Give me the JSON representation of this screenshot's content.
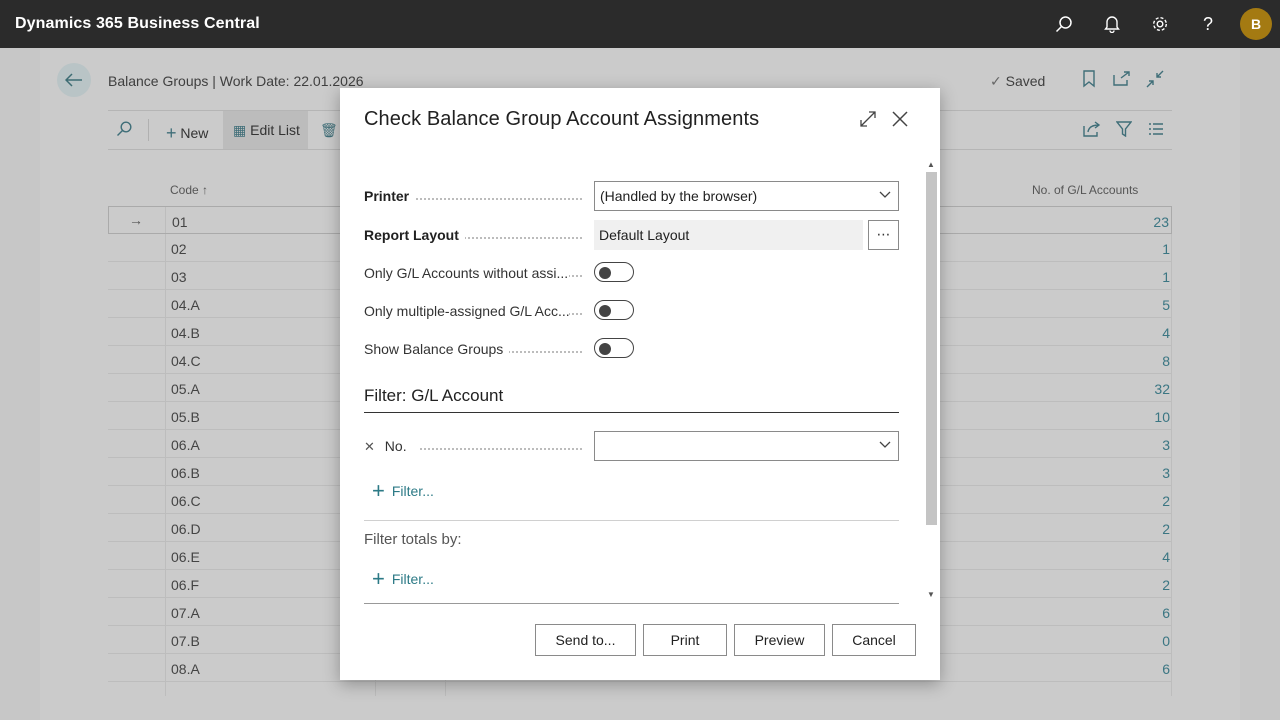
{
  "app": {
    "title": "Dynamics 365 Business Central",
    "avatar_initial": "B",
    "icons": [
      "search-icon",
      "bell-icon",
      "gear-icon",
      "help-icon"
    ]
  },
  "page": {
    "caption": "Balance Groups | Work Date: 22.01.2026",
    "saved_label": "Saved",
    "actions": {
      "new_label": "New",
      "edit_list_label": "Edit List"
    },
    "columns": {
      "code": "Code ↑",
      "count": "No. of G/L Accounts"
    },
    "rows": [
      {
        "code": "01",
        "count": "23"
      },
      {
        "code": "02",
        "count": "1"
      },
      {
        "code": "03",
        "count": "1"
      },
      {
        "code": "04.A",
        "count": "5"
      },
      {
        "code": "04.B",
        "count": "4"
      },
      {
        "code": "04.C",
        "count": "8"
      },
      {
        "code": "05.A",
        "count": "32"
      },
      {
        "code": "05.B",
        "count": "10"
      },
      {
        "code": "06.A",
        "count": "3"
      },
      {
        "code": "06.B",
        "count": "3"
      },
      {
        "code": "06.C",
        "count": "2"
      },
      {
        "code": "06.D",
        "count": "2"
      },
      {
        "code": "06.E",
        "count": "4"
      },
      {
        "code": "06.F",
        "count": "2"
      },
      {
        "code": "07.A",
        "count": "6"
      },
      {
        "code": "07.B",
        "count": "0"
      },
      {
        "code": "08.A",
        "count": "6"
      }
    ]
  },
  "dialog": {
    "title": "Check Balance Group Account Assignments",
    "printer": {
      "label": "Printer",
      "value": "(Handled by the browser)"
    },
    "report_layout": {
      "label": "Report Layout",
      "value": "Default Layout",
      "more": "⋯"
    },
    "options": [
      {
        "label": "Only G/L Accounts without assi...",
        "on": false
      },
      {
        "label": "Only multiple-assigned G/L Acc...",
        "on": false
      },
      {
        "label": "Show Balance Groups",
        "on": false
      }
    ],
    "filter_section_title": "Filter: G/L Account",
    "no_filter": {
      "label": "No.",
      "value": ""
    },
    "add_filter_label": "Filter...",
    "totals_label": "Filter totals by:",
    "add_totals_filter_label": "Filter...",
    "buttons": {
      "send_to": "Send to...",
      "print": "Print",
      "preview": "Preview",
      "cancel": "Cancel"
    }
  }
}
